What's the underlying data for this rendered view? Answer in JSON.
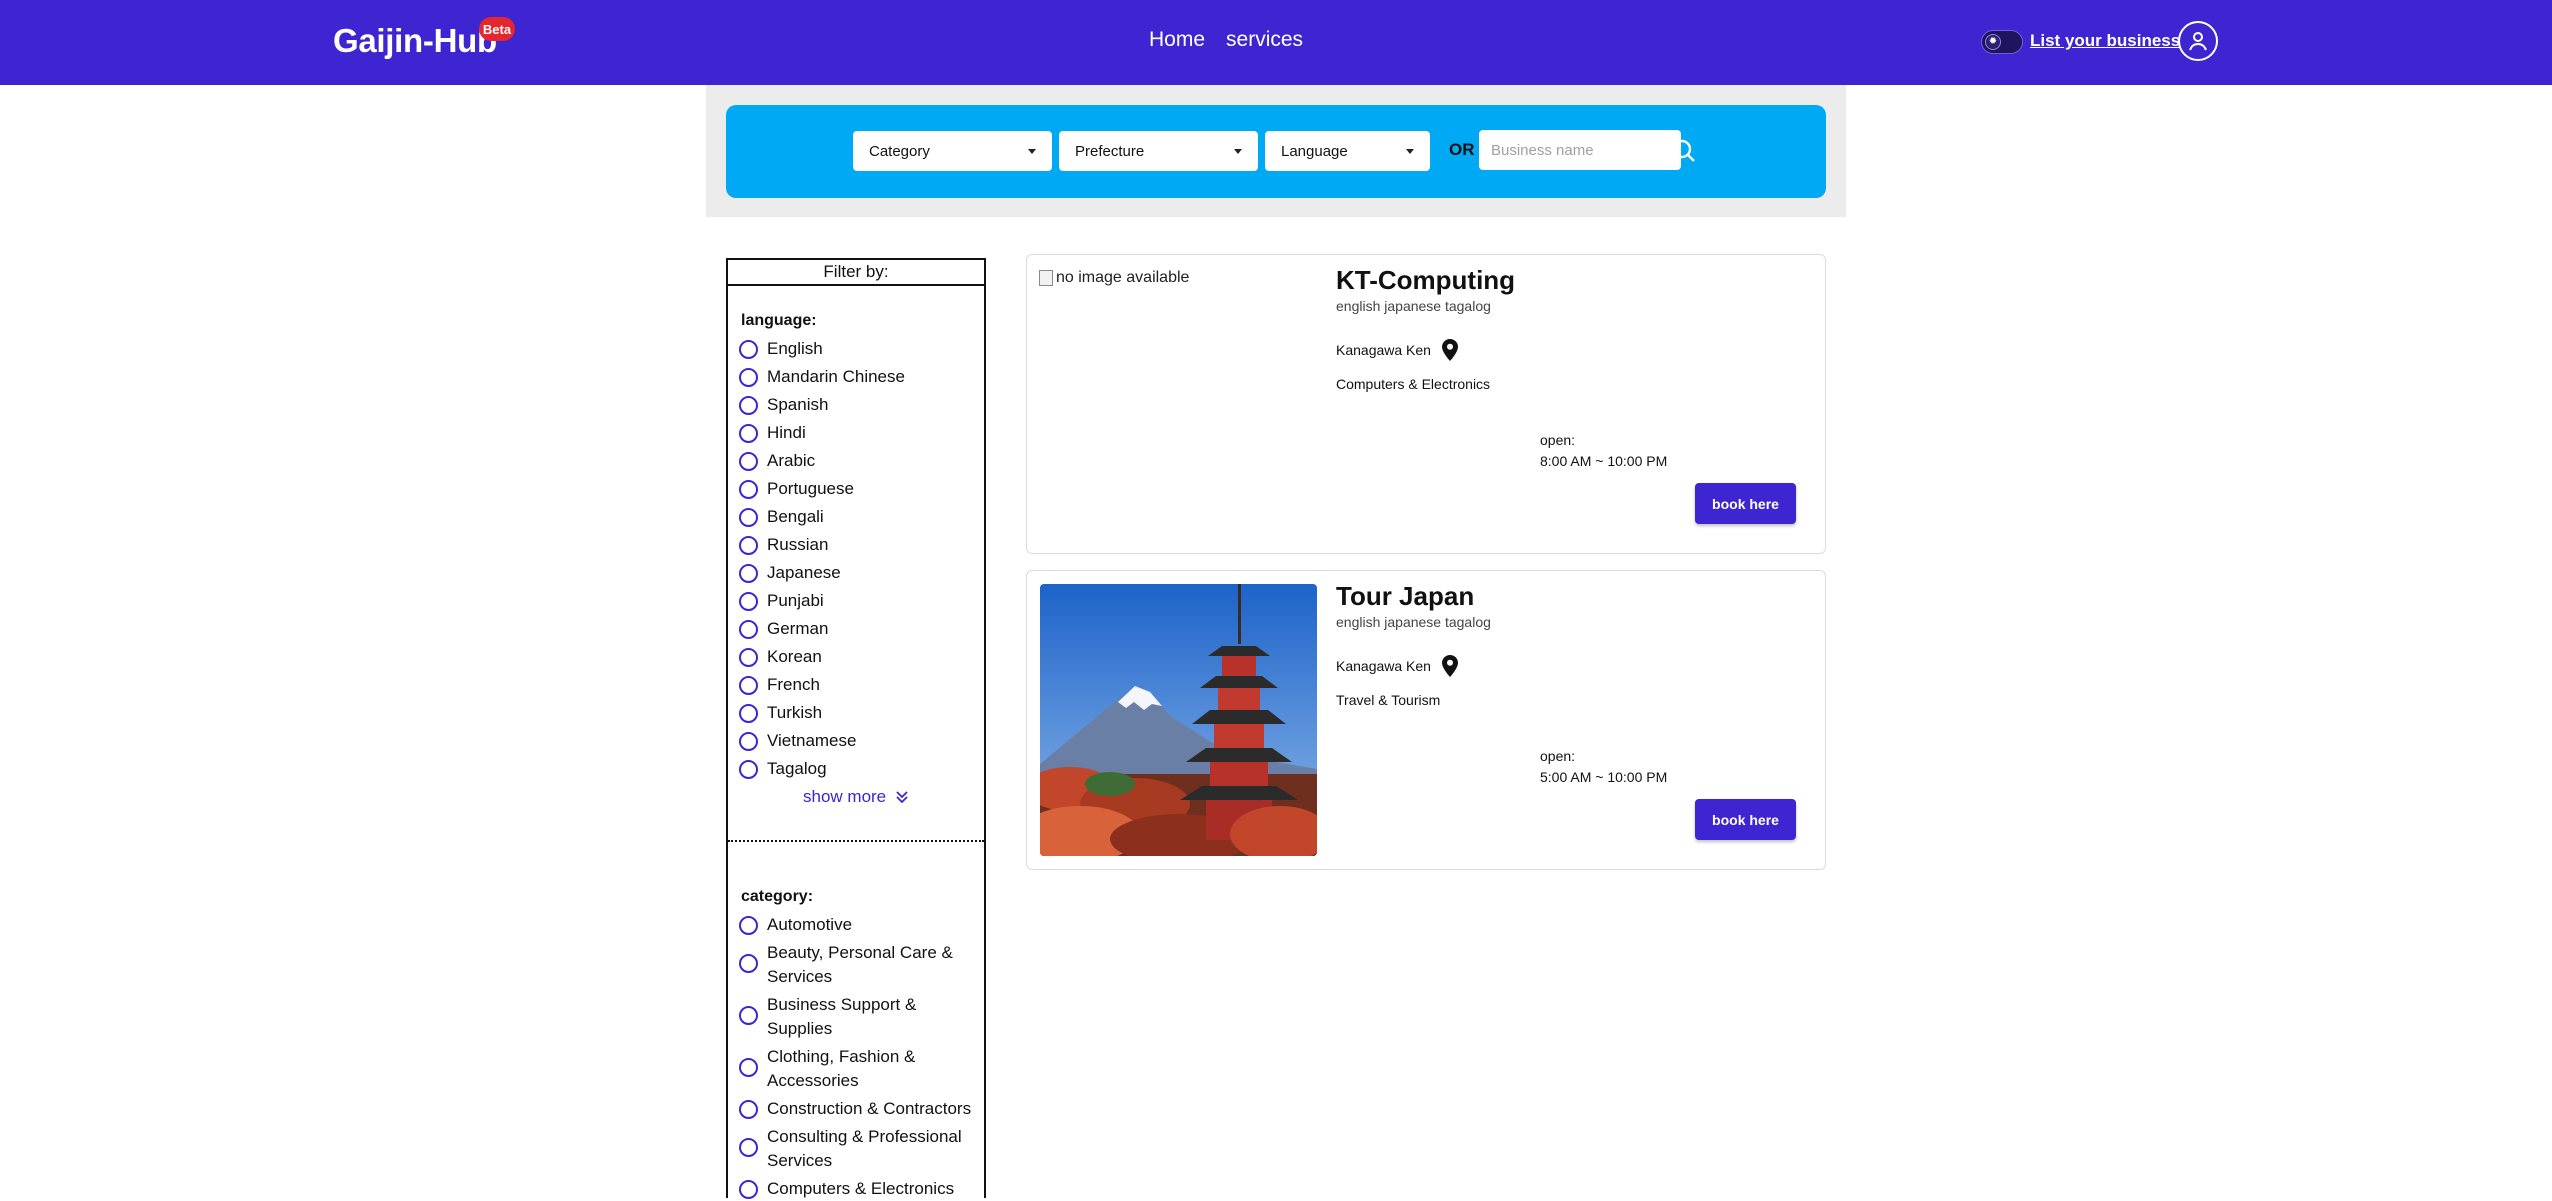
{
  "nav": {
    "brand": "Gaijin-Hub",
    "badge": "Beta",
    "links": [
      "Home",
      "services"
    ],
    "list_business": "List your business",
    "toggle_icon": "sun-icon",
    "user_icon": "user-icon"
  },
  "search": {
    "category": "Category",
    "prefecture": "Prefecture",
    "language": "Language",
    "or": "OR",
    "placeholder": "Business name"
  },
  "filter": {
    "header": "Filter by:",
    "language_title": "language:",
    "languages": [
      "English",
      "Mandarin Chinese",
      "Spanish",
      "Hindi",
      "Arabic",
      "Portuguese",
      "Bengali",
      "Russian",
      "Japanese",
      "Punjabi",
      "German",
      "Korean",
      "French",
      "Turkish",
      "Vietnamese",
      "Tagalog"
    ],
    "show_more": "show more",
    "category_title": "category:",
    "categories": [
      "Automotive",
      "Beauty, Personal Care & Services",
      "Business Support & Supplies",
      "Clothing, Fashion & Accessories",
      "Construction & Contractors",
      "Consulting & Professional Services",
      "Computers & Electronics"
    ]
  },
  "results": [
    {
      "title": "KT-Computing",
      "languages": "english japanese tagalog",
      "location": "Kanagawa Ken",
      "category": "Computers & Electronics",
      "open_label": "open:",
      "hours": "8:00 AM ~ 10:00 PM",
      "image_alt": "no image available",
      "button": "book here"
    },
    {
      "title": "Tour Japan",
      "languages": "english japanese tagalog",
      "location": "Kanagawa Ken",
      "category": "Travel & Tourism",
      "open_label": "open:",
      "hours": "5:00 AM ~ 10:00 PM",
      "image_alt": "Mount Fuji with pagoda",
      "button": "book here"
    }
  ],
  "colors": {
    "brand": "#3d25d1",
    "search_bar": "#00a9f4",
    "badge": "#e5262f"
  }
}
